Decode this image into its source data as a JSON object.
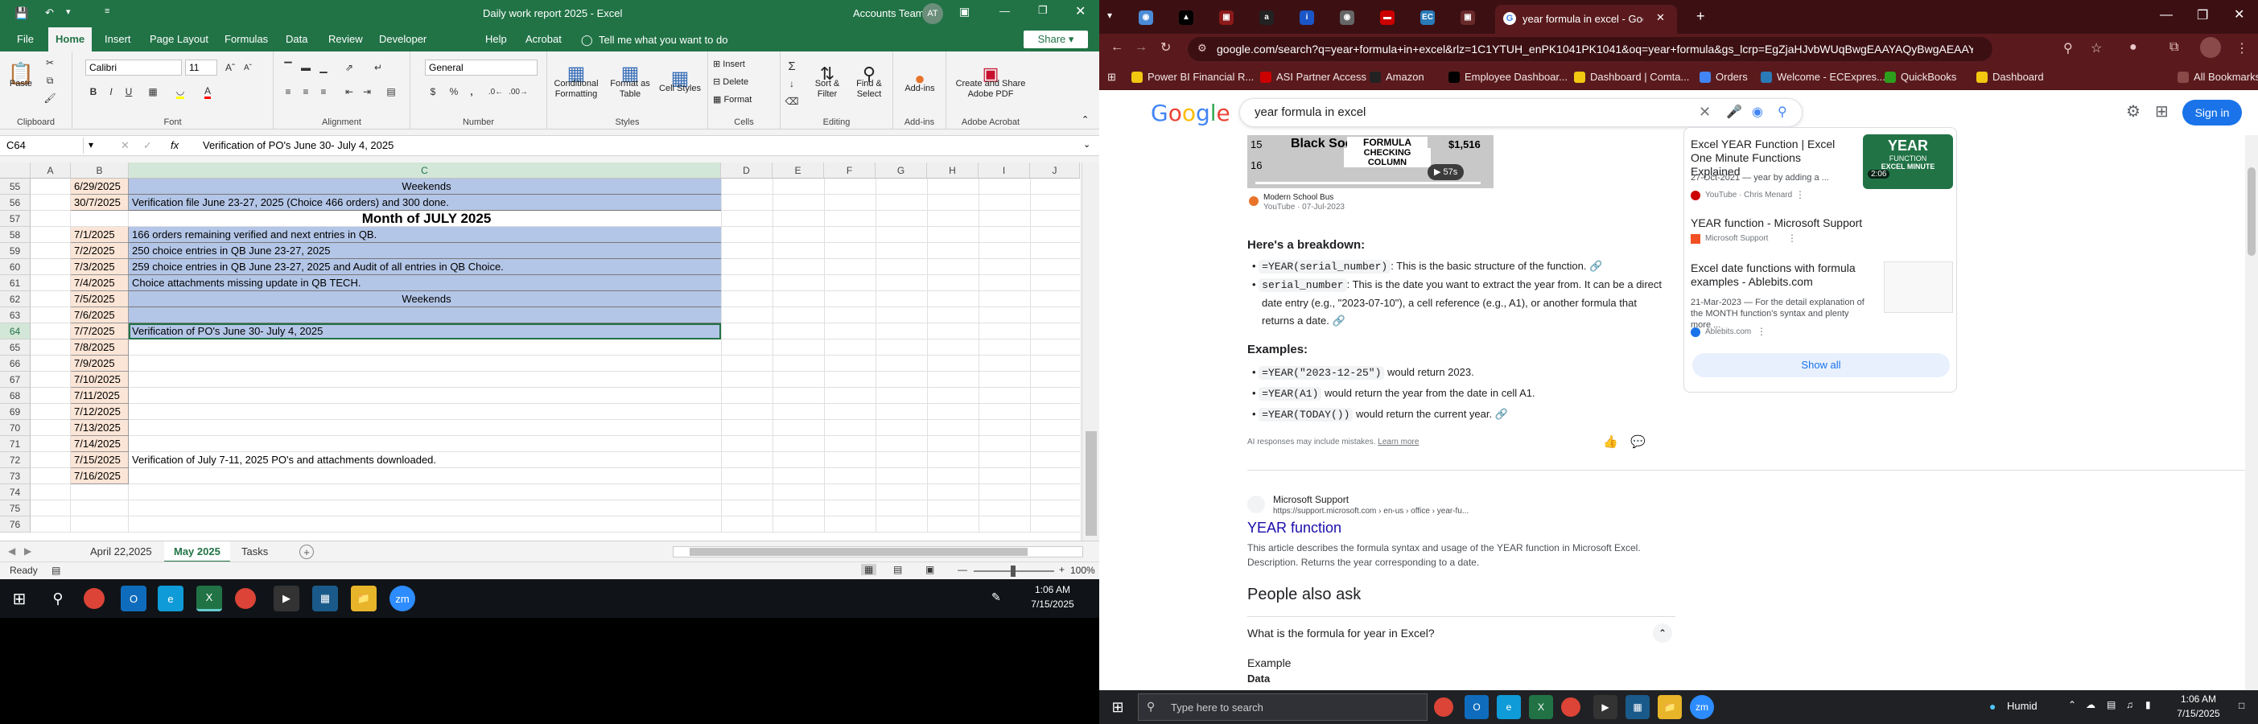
{
  "excel": {
    "title": "Daily work report 2025  -  Excel",
    "account": "Accounts Team",
    "avatar": "AT",
    "share": "Share",
    "tell_me": "Tell me what you want to do",
    "tabs": [
      "File",
      "Home",
      "Insert",
      "Page Layout",
      "Formulas",
      "Data",
      "Review",
      "Developer",
      "Help",
      "Acrobat"
    ],
    "active_tab": "Home",
    "font_name": "Calibri",
    "font_size": "11",
    "number_format": "General",
    "ribbon": {
      "clipboard": "Clipboard",
      "font": "Font",
      "alignment": "Alignment",
      "number": "Number",
      "styles": "Styles",
      "cells": "Cells",
      "editing": "Editing",
      "addins": "Add-ins",
      "adobe": "Adobe Acrobat",
      "paste": "Paste",
      "conditional": "Conditional Formatting",
      "format_table": "Format as Table",
      "cell_styles": "Cell Styles",
      "insert": "Insert",
      "delete": "Delete",
      "format": "Format",
      "sort": "Sort & Filter",
      "find": "Find & Select",
      "addins_btn": "Add-ins",
      "create_pdf": "Create and Share Adobe PDF",
      "sum": "Σ",
      "b": "B",
      "i": "I",
      "u": "U",
      "dollar": "$",
      "pct": "%",
      "comma": ","
    },
    "name_box": "C64",
    "fx": "fx",
    "formula": "Verification of PO's June 30- July 4, 2025",
    "columns": [
      "A",
      "B",
      "C",
      "D",
      "E",
      "F",
      "G",
      "H",
      "I",
      "J"
    ],
    "rows": [
      {
        "n": "55",
        "date": "6/29/2025",
        "text": "Weekends",
        "center": true,
        "blue": true
      },
      {
        "n": "56",
        "date": "30/7/2025",
        "text": "Verification file June 23-27, 2025 (Choice 466 orders) and 300 done.",
        "blue": true
      },
      {
        "n": "57",
        "date": "",
        "text": "Month of JULY 2025",
        "center": true,
        "bold": true
      },
      {
        "n": "58",
        "date": "7/1/2025",
        "text": "166 orders remaining verified and next entries in QB.",
        "blue": true
      },
      {
        "n": "59",
        "date": "7/2/2025",
        "text": "250 choice entries in QB June 23-27, 2025",
        "blue": true
      },
      {
        "n": "60",
        "date": "7/3/2025",
        "text": "259 choice entries in QB June 23-27, 2025 and Audit of all entries in QB Choice.",
        "blue": true
      },
      {
        "n": "61",
        "date": "7/4/2025",
        "text": "Choice attachments missing update in QB TECH.",
        "blue": true
      },
      {
        "n": "62",
        "date": "7/5/2025",
        "text": "Weekends",
        "center": true,
        "blue": true
      },
      {
        "n": "63",
        "date": "7/6/2025",
        "text": "",
        "blue": true
      },
      {
        "n": "64",
        "date": "7/7/2025",
        "text": "Verification of  PO's June 30- July 4, 2025",
        "blue": true,
        "selected": true
      },
      {
        "n": "65",
        "date": "7/8/2025",
        "text": ""
      },
      {
        "n": "66",
        "date": "7/9/2025",
        "text": ""
      },
      {
        "n": "67",
        "date": "7/10/2025",
        "text": ""
      },
      {
        "n": "68",
        "date": "7/11/2025",
        "text": ""
      },
      {
        "n": "69",
        "date": "7/12/2025",
        "text": ""
      },
      {
        "n": "70",
        "date": "7/13/2025",
        "text": ""
      },
      {
        "n": "71",
        "date": "7/14/2025",
        "text": ""
      },
      {
        "n": "72",
        "date": "7/15/2025",
        "text": "Verification of July 7-11, 2025 PO's and attachments downloaded."
      },
      {
        "n": "73",
        "date": "7/16/2025",
        "text": ""
      },
      {
        "n": "74",
        "date": "",
        "text": ""
      },
      {
        "n": "75",
        "date": "",
        "text": ""
      },
      {
        "n": "76",
        "date": "",
        "text": ""
      }
    ],
    "sheets": [
      "April 22,2025",
      "May 2025",
      "Tasks"
    ],
    "active_sheet": "May 2025",
    "add_sheet": "+",
    "status": "Ready",
    "zoom": "100%",
    "time": "1:06 AM",
    "date": "7/15/2025"
  },
  "chrome": {
    "tab_title": "year formula in excel - Google",
    "url": "google.com/search?q=year+formula+in+excel&rlz=1C1YTUH_enPK1041PK1041&oq=year+formula&gs_lcrp=EgZjaHJvbWUqBwgEAAYAQyBwgAEAAYAQyBwgBEGG...",
    "bookmarks": [
      "Power BI Financial R...",
      "ASI Partner Access",
      "Amazon",
      "Employee Dashboar...",
      "Dashboard | Comta...",
      "Orders",
      "Welcome - ECExpres...",
      "QuickBooks",
      "Dashboard"
    ],
    "all_bookmarks": "All Bookmarks",
    "search_query": "year formula in excel",
    "sign_in": "Sign in",
    "google_logo": "Google",
    "video": {
      "line1": "Black Socks",
      "line2": "FORMULA",
      "line3": "CHECKING COLUMN",
      "num1": "15",
      "num2": "16",
      "value": "$1,516",
      "duration": "57s",
      "channel": "Modern School Bus",
      "source": "YouTube · 07-Jul-2023"
    },
    "breakdown_title": "Here's a breakdown:",
    "bullets": [
      {
        "code": "=YEAR(serial_number)",
        "text": ": This is the basic structure of the function."
      },
      {
        "code": "serial_number",
        "text": ": This is the date you want to extract the year from. It can be a direct date entry (e.g., \"2023-07-10\"), a cell reference (e.g., A1), or another formula that returns a date."
      }
    ],
    "examples_title": "Examples:",
    "examples": [
      {
        "code": "=YEAR(\"2023-12-25\")",
        "text": "would return 2023."
      },
      {
        "code": "=YEAR(A1)",
        "text": "would return the year from the date in cell A1."
      },
      {
        "code": "=YEAR(TODAY())",
        "text": "would return the current year."
      }
    ],
    "ai_note": "AI responses may include mistakes.",
    "learn_more": "Learn more",
    "side": [
      {
        "title": "Excel YEAR Function | Excel One Minute Functions Explained",
        "meta": "27-Oct-2021 — year by adding a ...",
        "src": "YouTube · Chris Menard",
        "thumb": "YEAR",
        "thumb2": "FUNCTION",
        "thumb3": "EXCEL MINUTE",
        "dur": "2:06"
      },
      {
        "title": "YEAR function - Microsoft Support",
        "meta": "",
        "src": "Microsoft Support"
      },
      {
        "title": "Excel date functions with formula examples - Ablebits.com",
        "meta": "21-Mar-2023 — For the detail explanation of the MONTH function's syntax and plenty more ...",
        "src": "Ablebits.com"
      }
    ],
    "show_all": "Show all",
    "ms_site": "Microsoft Support",
    "ms_url": "https://support.microsoft.com › en-us › office › year-fu...",
    "ms_title": "YEAR function",
    "ms_desc": "This article describes the formula syntax and usage of the YEAR function in Microsoft Excel. Description. Returns the year corresponding to a date.",
    "paa_title": "People also ask",
    "paa_q": "What is the formula for year in Excel?",
    "paa_a1": "Example",
    "paa_a2": "Data"
  },
  "taskbar2": {
    "search": "Type here to search",
    "weather": "Humid",
    "time": "1:06 AM",
    "date": "7/15/2025"
  }
}
